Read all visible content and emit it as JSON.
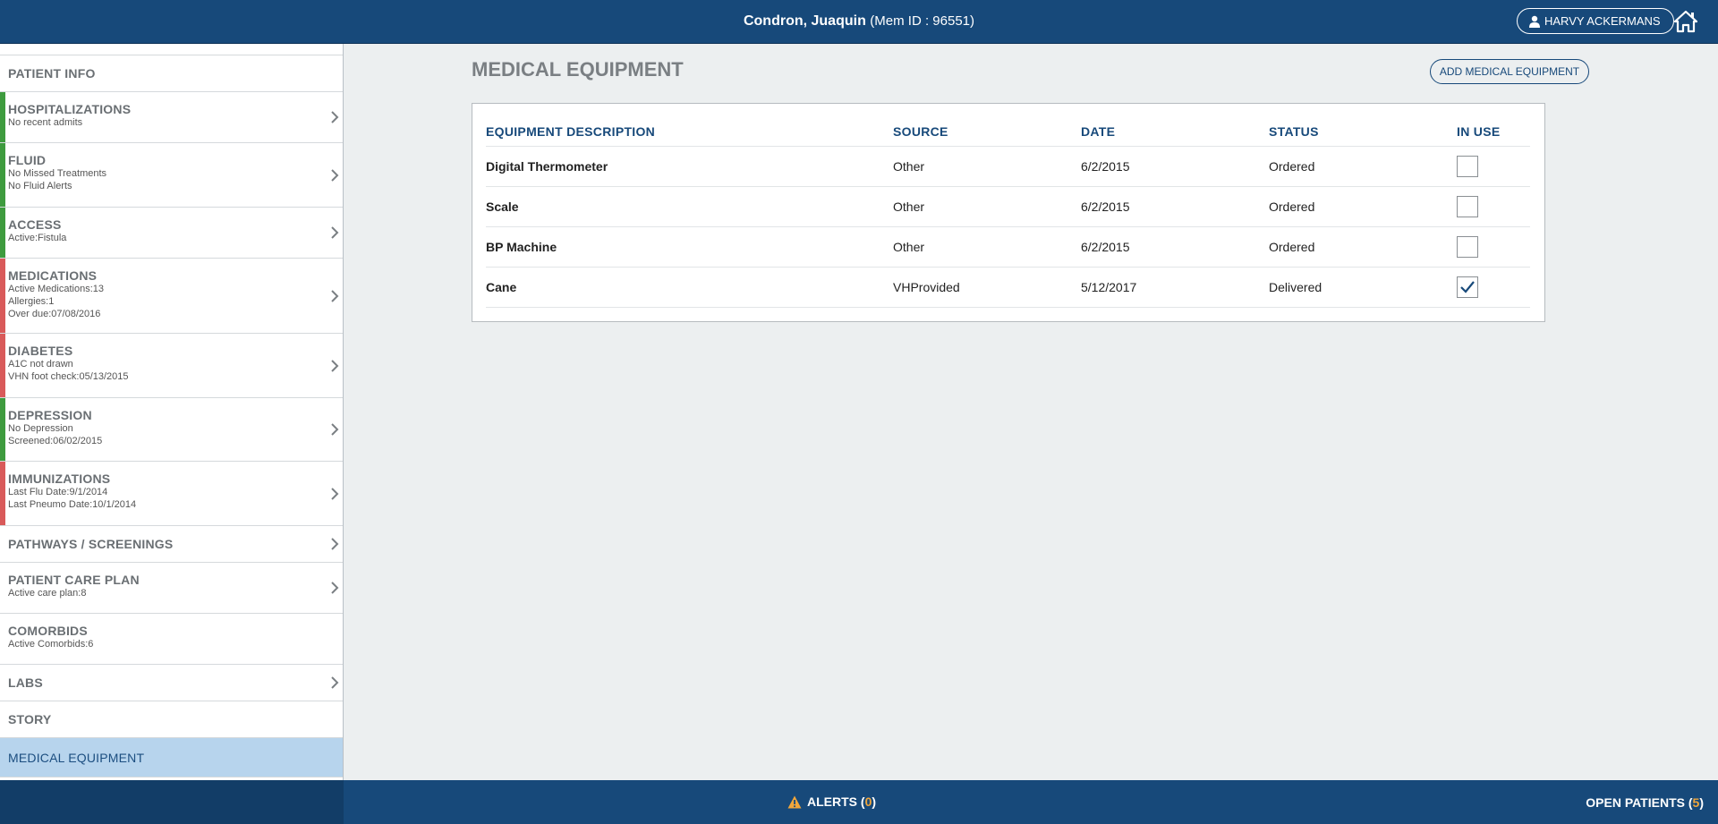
{
  "header": {
    "patient_name": "Condron, Juaquin",
    "member_id": "(Mem ID : 96551)",
    "user_name": "HARVY ACKERMANS",
    "user_icon": "user-icon",
    "home_icon": "home-icon"
  },
  "sidebar": {
    "items": [
      {
        "title": "PATIENT INFO",
        "lines": [],
        "status": "none",
        "chevron": false
      },
      {
        "title": "HOSPITALIZATIONS",
        "lines": [
          "No recent admits"
        ],
        "status": "green",
        "chevron": true
      },
      {
        "title": "FLUID",
        "lines": [
          "No Missed Treatments",
          "No Fluid Alerts"
        ],
        "status": "green",
        "chevron": true
      },
      {
        "title": "ACCESS",
        "lines": [
          "Active:Fistula"
        ],
        "status": "green",
        "chevron": true
      },
      {
        "title": "MEDICATIONS",
        "lines": [
          "Active Medications:13",
          "Allergies:1",
          "Over due:07/08/2016"
        ],
        "status": "red",
        "chevron": true
      },
      {
        "title": "DIABETES",
        "lines": [
          "A1C not drawn",
          "VHN foot check:05/13/2015"
        ],
        "status": "red",
        "chevron": true
      },
      {
        "title": "DEPRESSION",
        "lines": [
          "No Depression",
          "Screened:06/02/2015"
        ],
        "status": "green",
        "chevron": true
      },
      {
        "title": "IMMUNIZATIONS",
        "lines": [
          "Last Flu Date:9/1/2014",
          "Last Pneumo Date:10/1/2014"
        ],
        "status": "red",
        "chevron": true
      },
      {
        "title": "PATHWAYS / SCREENINGS",
        "lines": [],
        "status": "none",
        "chevron": true
      },
      {
        "title": "PATIENT CARE PLAN",
        "lines": [
          "Active care plan:8"
        ],
        "status": "none",
        "chevron": true
      },
      {
        "title": "COMORBIDS",
        "lines": [
          "Active Comorbids:6"
        ],
        "status": "none",
        "chevron": false
      },
      {
        "title": "LABS",
        "lines": [],
        "status": "none",
        "chevron": true
      },
      {
        "title": "STORY",
        "lines": [],
        "status": "none",
        "chevron": false
      },
      {
        "title": "MEDICAL EQUIPMENT",
        "lines": [],
        "status": "none",
        "chevron": false,
        "active": true
      }
    ]
  },
  "main": {
    "title": "MEDICAL EQUIPMENT",
    "add_button": "ADD MEDICAL EQUIPMENT",
    "columns": [
      "EQUIPMENT DESCRIPTION",
      "SOURCE",
      "DATE",
      "STATUS",
      "IN USE"
    ],
    "rows": [
      {
        "description": "Digital Thermometer",
        "source": "Other",
        "date": "6/2/2015",
        "status": "Ordered",
        "in_use": false
      },
      {
        "description": "Scale",
        "source": "Other",
        "date": "6/2/2015",
        "status": "Ordered",
        "in_use": false
      },
      {
        "description": "BP Machine",
        "source": "Other",
        "date": "6/2/2015",
        "status": "Ordered",
        "in_use": false
      },
      {
        "description": "Cane",
        "source": "VHProvided",
        "date": "5/12/2017",
        "status": "Delivered",
        "in_use": true
      }
    ]
  },
  "footer": {
    "alerts_label": "ALERTS",
    "alerts_open": "(",
    "alerts_count": "0",
    "alerts_close": ")",
    "open_patients_label": "OPEN PATIENTS",
    "open_patients_open": "(",
    "open_patients_count": "5",
    "open_patients_close": ")",
    "alert_icon": "warning-icon"
  },
  "colors": {
    "brand": "#17497A",
    "status_green": "#3E9B3E",
    "status_red": "#D95A5A",
    "active_item": "#B7D4ED",
    "count_accent": "#F0A63B"
  }
}
